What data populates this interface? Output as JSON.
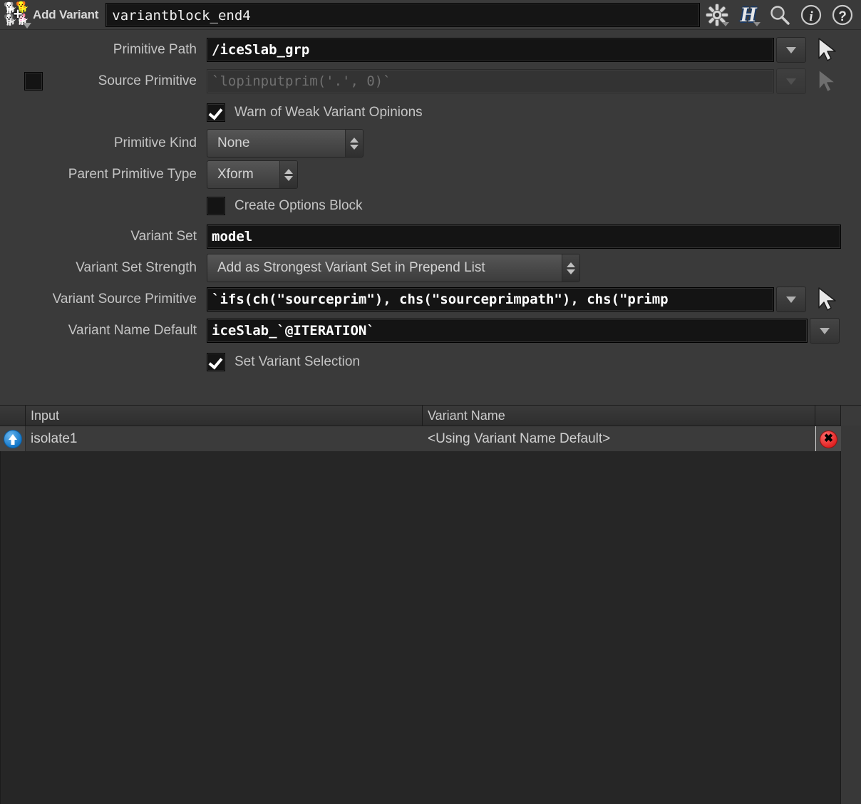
{
  "titlebar": {
    "node_type_label": "Add Variant",
    "node_name": "variantblock_end4",
    "node_icon": "add-variant-lop-icon",
    "icons": [
      {
        "name": "gear-icon",
        "label": "⚙"
      },
      {
        "name": "houdini-h-icon",
        "label": "H"
      },
      {
        "name": "search-icon",
        "label": "🔍"
      },
      {
        "name": "info-icon",
        "label": "i"
      },
      {
        "name": "help-icon",
        "label": "?"
      }
    ]
  },
  "params": {
    "primitive_path": {
      "label": "Primitive Path",
      "value": "/iceSlab_grp"
    },
    "source_primitive": {
      "label": "Source Primitive",
      "value": "`lopinputprim('.', 0)`",
      "enabled": false,
      "toggle_checked": false
    },
    "warn_weak": {
      "label": "Warn of Weak Variant Opinions",
      "checked": true
    },
    "primitive_kind": {
      "label": "Primitive Kind",
      "value": "None"
    },
    "parent_primitive_type": {
      "label": "Parent Primitive Type",
      "value": "Xform"
    },
    "create_options_block": {
      "label": "Create Options Block",
      "checked": false
    },
    "variant_set": {
      "label": "Variant Set",
      "value": "model"
    },
    "variant_set_strength": {
      "label": "Variant Set Strength",
      "value": "Add as Strongest Variant Set in Prepend List"
    },
    "variant_source_primitive": {
      "label": "Variant Source Primitive",
      "value": "`ifs(ch(\"sourceprim\"), chs(\"sourceprimpath\"), chs(\"primp"
    },
    "variant_name_default": {
      "label": "Variant Name Default",
      "value": "iceSlab_`@ITERATION`"
    },
    "set_variant_selection": {
      "label": "Set Variant Selection",
      "checked": true
    }
  },
  "table": {
    "columns": [
      "",
      "Input",
      "Variant Name",
      ""
    ],
    "rows": [
      {
        "jump_icon": "blue-up-arrow-icon",
        "input": "isolate1",
        "variant_name": "<Using Variant Name Default>",
        "delete_icon": "red-delete-icon",
        "delete_label": "✖"
      }
    ]
  },
  "colors": {
    "background": "#3a3a3a",
    "field_background": "#141414",
    "accent_blue": "#1477c8",
    "accent_red": "#e02222",
    "text": "#c8c8c8"
  }
}
